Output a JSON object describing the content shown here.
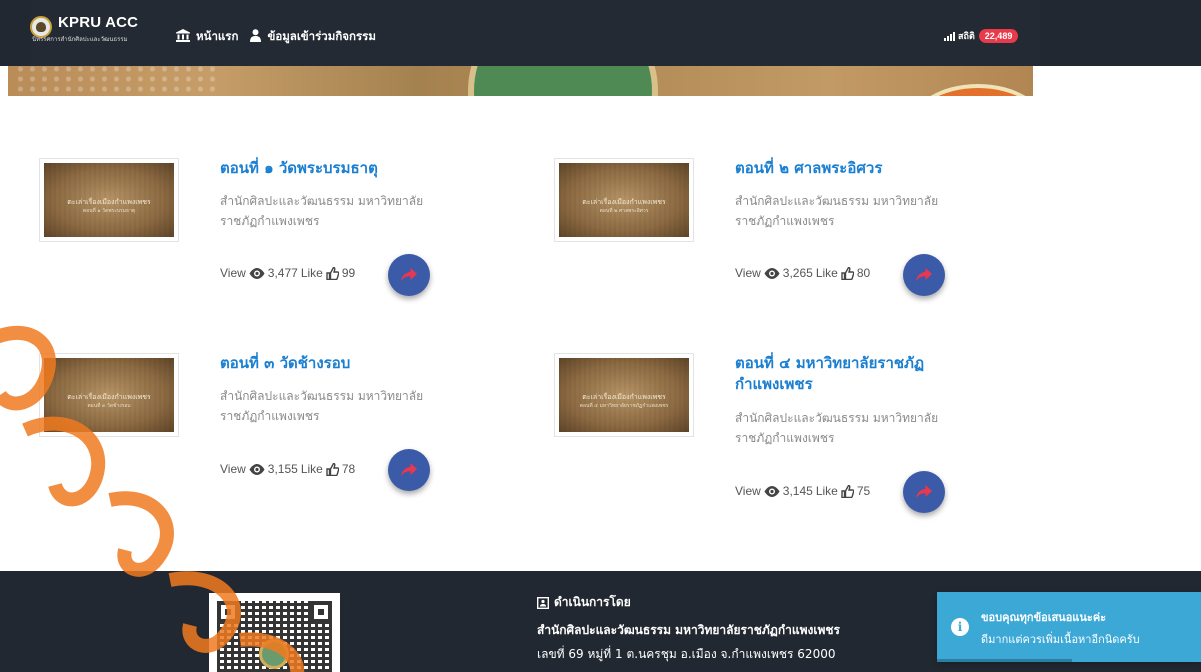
{
  "header": {
    "brand_title": "KPRU ACC",
    "brand_subtitle": "นิทรรศการสำนักศิลปะและวัฒนธรรม",
    "nav": [
      {
        "label": "หน้าแรก",
        "icon": "bank-icon"
      },
      {
        "label": "ข้อมูลเข้าร่วมกิจกรรม",
        "icon": "user-icon"
      }
    ],
    "stats_label": "สถิติ",
    "stats_count": "22,489",
    "badge_color": "#e83a4a"
  },
  "episodes": [
    {
      "title": "ตอนที่ ๑ วัดพระบรมธาตุ",
      "desc": "สำนักศิลปะและวัฒนธรรม มหาวิทยาลัยราชภัฏกำแพงเพชร",
      "view_label": "View",
      "views": "3,477",
      "like_label": "Like",
      "likes": "99",
      "thumb_caption": "ตะเล่าเรื่องเมืองกำแพงเพชร",
      "thumb_sub": "ตอนที่ ๑ วัดพระบรมธาตุ"
    },
    {
      "title": "ตอนที่ ๒ ศาลพระอิศวร",
      "desc": "สำนักศิลปะและวัฒนธรรม มหาวิทยาลัยราชภัฏกำแพงเพชร",
      "view_label": "View",
      "views": "3,265",
      "like_label": "Like",
      "likes": "80",
      "thumb_caption": "ตะเล่าเรื่องเมืองกำแพงเพชร",
      "thumb_sub": "ตอนที่ ๒ ศาลพระอิศวร"
    },
    {
      "title": "ตอนที่ ๓ วัดช้างรอบ",
      "desc": "สำนักศิลปะและวัฒนธรรม มหาวิทยาลัยราชภัฏกำแพงเพชร",
      "view_label": "View",
      "views": "3,155",
      "like_label": "Like",
      "likes": "78",
      "thumb_caption": "ตะเล่าเรื่องเมืองกำแพงเพชร",
      "thumb_sub": "ตอนที่ ๓ วัดช้างรอบ"
    },
    {
      "title": "ตอนที่ ๔ มหาวิทยาลัยราชภัฏกำแพงเพชร",
      "desc": "สำนักศิลปะและวัฒนธรรม มหาวิทยาลัยราชภัฏกำแพงเพชร",
      "view_label": "View",
      "views": "3,145",
      "like_label": "Like",
      "likes": "75",
      "thumb_caption": "ตะเล่าเรื่องเมืองกำแพงเพชร",
      "thumb_sub": "ตอนที่ ๔ มหาวิทยาลัยราชภัฏกำแพงเพชร"
    }
  ],
  "footer": {
    "operated_by": "ดำเนินการโดย",
    "address_line1": "สำนักศิลปะและวัฒนธรรม มหาวิทยาลัยราชภัฏกำแพงเพชร",
    "address_line2": "เลขที่ 69 หมู่ที่ 1 ต.นครชุม อ.เมือง จ.กำแพงเพชร 62000"
  },
  "toast": {
    "line1": "ขอบคุณทุกข้อเสนอแนะค่ะ",
    "line2": "ดีมากแต่ควรเพิ่มเนื้อหาอีกนิดครับ",
    "icon": "info-icon",
    "color": "#3ba8d6"
  },
  "colors": {
    "title_blue": "#1a7fd1",
    "share_button": "#3b5aa8",
    "share_arrow": "#e8384f",
    "navbar": "#222831"
  }
}
